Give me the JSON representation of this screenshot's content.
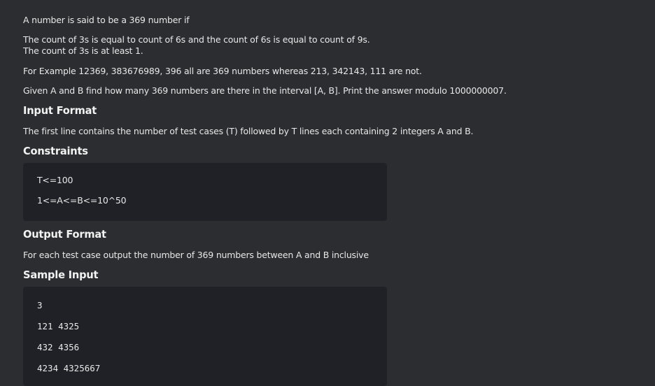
{
  "problem": {
    "intro": "A number is said to be a 369 number if",
    "condition_1": "The count of 3s is equal to count of 6s and the count of 6s is equal to count of 9s.",
    "condition_2": "The count of 3s is at least 1.",
    "example": "For Example 12369, 383676989, 396 all are 369 numbers whereas 213, 342143, 111 are not.",
    "task": "Given A and B find how many 369 numbers are there in the interval [A, B]. Print the answer modulo 1000000007."
  },
  "input_format": {
    "heading": "Input Format",
    "description": "The first line contains the number of test cases (T) followed by T lines each containing 2 integers A and B."
  },
  "constraints": {
    "heading": "Constraints",
    "lines": [
      "T<=100",
      "1<=A<=B<=10^50"
    ]
  },
  "output_format": {
    "heading": "Output Format",
    "description": "For each test case output the number of 369 numbers between A and B inclusive"
  },
  "sample_input": {
    "heading": "Sample Input",
    "lines": [
      "3",
      "121 4325",
      "432 4356",
      "4234 4325667"
    ]
  }
}
